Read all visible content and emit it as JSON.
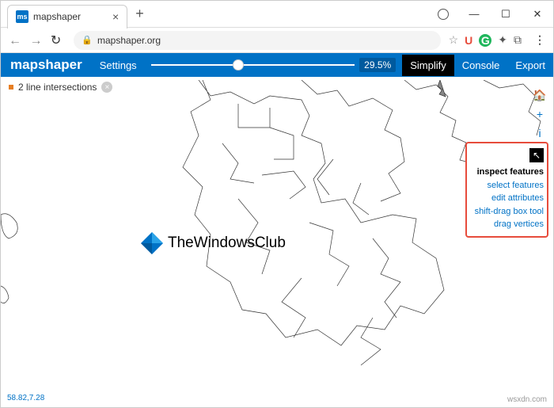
{
  "browser": {
    "tab_title": "mapshaper",
    "tab_favicon_text": "ms",
    "url_host": "mapshaper.org",
    "url_rest": "",
    "new_tab": "+",
    "close_tab": "×",
    "minimize": "—",
    "maximize": "☐",
    "close_win": "✕",
    "back": "←",
    "forward": "→",
    "reload": "↻",
    "lock": "🔒",
    "star": "☆",
    "u_ext": "U",
    "grammarly": "G",
    "puzzle": "✦",
    "readlist": "⧉",
    "menu_dots": "⋮"
  },
  "app": {
    "brand": "mapshaper",
    "nav_settings": "Settings",
    "percent": "29.5%",
    "simplify": "Simplify",
    "console": "Console",
    "export": "Export"
  },
  "msg": {
    "text": "2 line intersections",
    "close": "×"
  },
  "tools": {
    "home": "🏠",
    "plus": "+",
    "info": "i",
    "minus": "−"
  },
  "popup": {
    "cursor": "↖",
    "item1": "inspect features",
    "item2": "select features",
    "item3": "edit attributes",
    "item4": "shift-drag box tool",
    "item5": "drag vertices"
  },
  "watermark": {
    "text": "TheWindowsClub"
  },
  "coords": "58.82,7.28",
  "footer": "wsxdn.com"
}
